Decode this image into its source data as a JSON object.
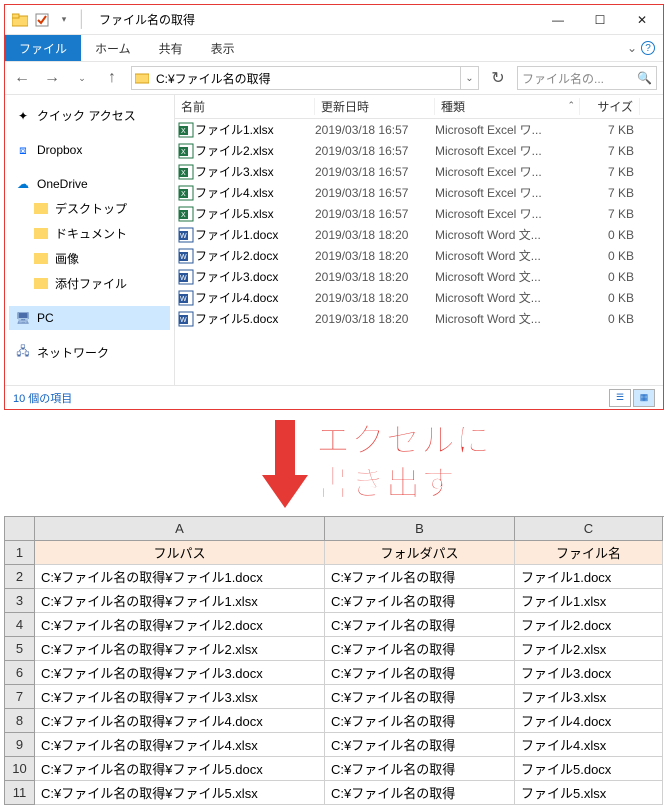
{
  "window": {
    "title": "ファイル名の取得",
    "tabs": {
      "file": "ファイル",
      "home": "ホーム",
      "share": "共有",
      "view": "表示"
    },
    "address": "C:¥ファイル名の取得",
    "search_placeholder": "ファイル名の...",
    "status": "10 個の項目"
  },
  "nav": {
    "quick": "クイック アクセス",
    "dropbox": "Dropbox",
    "onedrive": "OneDrive",
    "desktop": "デスクトップ",
    "documents": "ドキュメント",
    "pictures": "画像",
    "attach": "添付ファイル",
    "pc": "PC",
    "network": "ネットワーク"
  },
  "columns": {
    "name": "名前",
    "date": "更新日時",
    "type": "種類",
    "size": "サイズ"
  },
  "files": [
    {
      "name": "ファイル1.xlsx",
      "date": "2019/03/18 16:57",
      "type": "Microsoft Excel ワ...",
      "size": "7 KB",
      "icon": "xls"
    },
    {
      "name": "ファイル2.xlsx",
      "date": "2019/03/18 16:57",
      "type": "Microsoft Excel ワ...",
      "size": "7 KB",
      "icon": "xls"
    },
    {
      "name": "ファイル3.xlsx",
      "date": "2019/03/18 16:57",
      "type": "Microsoft Excel ワ...",
      "size": "7 KB",
      "icon": "xls"
    },
    {
      "name": "ファイル4.xlsx",
      "date": "2019/03/18 16:57",
      "type": "Microsoft Excel ワ...",
      "size": "7 KB",
      "icon": "xls"
    },
    {
      "name": "ファイル5.xlsx",
      "date": "2019/03/18 16:57",
      "type": "Microsoft Excel ワ...",
      "size": "7 KB",
      "icon": "xls"
    },
    {
      "name": "ファイル1.docx",
      "date": "2019/03/18 18:20",
      "type": "Microsoft Word 文...",
      "size": "0 KB",
      "icon": "doc"
    },
    {
      "name": "ファイル2.docx",
      "date": "2019/03/18 18:20",
      "type": "Microsoft Word 文...",
      "size": "0 KB",
      "icon": "doc"
    },
    {
      "name": "ファイル3.docx",
      "date": "2019/03/18 18:20",
      "type": "Microsoft Word 文...",
      "size": "0 KB",
      "icon": "doc"
    },
    {
      "name": "ファイル4.docx",
      "date": "2019/03/18 18:20",
      "type": "Microsoft Word 文...",
      "size": "0 KB",
      "icon": "doc"
    },
    {
      "name": "ファイル5.docx",
      "date": "2019/03/18 18:20",
      "type": "Microsoft Word 文...",
      "size": "0 KB",
      "icon": "doc"
    }
  ],
  "caption": {
    "line1": "エクセルに",
    "line2": "書き出す"
  },
  "excel": {
    "col_letters": [
      "A",
      "B",
      "C"
    ],
    "headers": {
      "A": "フルパス",
      "B": "フォルダパス",
      "C": "ファイル名"
    },
    "rows": [
      {
        "A": "C:¥ファイル名の取得¥ファイル1.docx",
        "B": "C:¥ファイル名の取得",
        "C": "ファイル1.docx"
      },
      {
        "A": "C:¥ファイル名の取得¥ファイル1.xlsx",
        "B": "C:¥ファイル名の取得",
        "C": "ファイル1.xlsx"
      },
      {
        "A": "C:¥ファイル名の取得¥ファイル2.docx",
        "B": "C:¥ファイル名の取得",
        "C": "ファイル2.docx"
      },
      {
        "A": "C:¥ファイル名の取得¥ファイル2.xlsx",
        "B": "C:¥ファイル名の取得",
        "C": "ファイル2.xlsx"
      },
      {
        "A": "C:¥ファイル名の取得¥ファイル3.docx",
        "B": "C:¥ファイル名の取得",
        "C": "ファイル3.docx"
      },
      {
        "A": "C:¥ファイル名の取得¥ファイル3.xlsx",
        "B": "C:¥ファイル名の取得",
        "C": "ファイル3.xlsx"
      },
      {
        "A": "C:¥ファイル名の取得¥ファイル4.docx",
        "B": "C:¥ファイル名の取得",
        "C": "ファイル4.docx"
      },
      {
        "A": "C:¥ファイル名の取得¥ファイル4.xlsx",
        "B": "C:¥ファイル名の取得",
        "C": "ファイル4.xlsx"
      },
      {
        "A": "C:¥ファイル名の取得¥ファイル5.docx",
        "B": "C:¥ファイル名の取得",
        "C": "ファイル5.docx"
      },
      {
        "A": "C:¥ファイル名の取得¥ファイル5.xlsx",
        "B": "C:¥ファイル名の取得",
        "C": "ファイル5.xlsx"
      }
    ]
  }
}
